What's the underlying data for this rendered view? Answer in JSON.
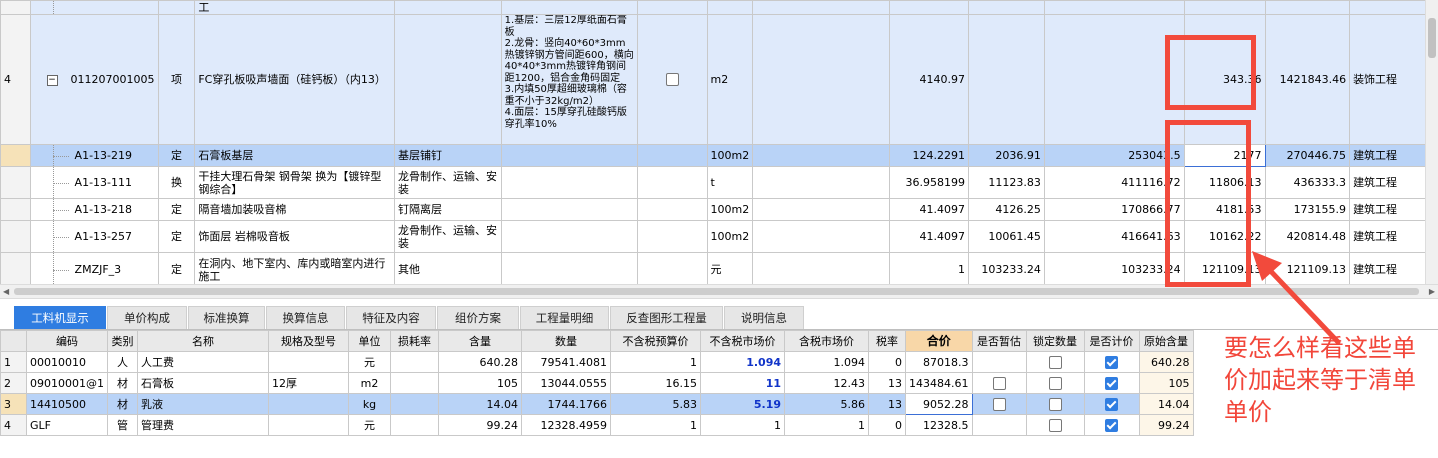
{
  "top_rows": [
    {
      "kind": "cut",
      "idx": "",
      "code": "",
      "type": "",
      "name": "工",
      "feature": "",
      "spec": "",
      "unit": "",
      "qty": "",
      "price": "",
      "total": "",
      "unitprice": "",
      "sum": "",
      "category": ""
    },
    {
      "kind": "item",
      "idx": "4",
      "code": "011207001005",
      "type": "项",
      "name": "FC穿孔板吸声墙面（硅钙板）（内13）",
      "feature": "",
      "spec": "1.基层：三层12厚纸面石膏板\n2.龙骨：竖向40*60*3mm热镀锌钢方管间距600，横向40*40*3mm热镀锌角钢间距1200，铝合金角码固定\n3.内填50厚超细玻璃棉（容重不小于32kg/m2）\n4.面层：15厚穿孔硅酸钙版穿孔率10%",
      "unit": "m2",
      "qty": "4140.97",
      "price": "",
      "total": "",
      "unitprice": "343.36",
      "sum": "1421843.46",
      "category": "装饰工程"
    },
    {
      "kind": "sel",
      "idx": "",
      "code": "A1-13-219",
      "type": "定",
      "name": "石膏板基层",
      "feature": "基层铺钉",
      "spec": "",
      "unit": "100m2",
      "qty": "124.2291",
      "price": "2036.91",
      "total": "253043.5",
      "unitprice": "2177",
      "sum": "270446.75",
      "category": "建筑工程"
    },
    {
      "kind": "plain",
      "idx": "",
      "code": "A1-13-111",
      "type": "换",
      "name": "干挂大理石骨架 钢骨架  换为【镀锌型钢综合】",
      "feature": "龙骨制作、运输、安装",
      "spec": "",
      "unit": "t",
      "qty": "36.958199",
      "price": "11123.83",
      "total": "411116.72",
      "unitprice": "11806.13",
      "sum": "436333.3",
      "category": "建筑工程"
    },
    {
      "kind": "plain",
      "idx": "",
      "code": "A1-13-218",
      "type": "定",
      "name": "隔音墙加装吸音棉",
      "feature": "钉隔离层",
      "spec": "",
      "unit": "100m2",
      "qty": "41.4097",
      "price": "4126.25",
      "total": "170866.77",
      "unitprice": "4181.53",
      "sum": "173155.9",
      "category": "建筑工程"
    },
    {
      "kind": "plain",
      "idx": "",
      "code": "A1-13-257",
      "type": "定",
      "name": "饰面层 岩棉吸音板",
      "feature": "龙骨制作、运输、安装",
      "spec": "",
      "unit": "100m2",
      "qty": "41.4097",
      "price": "10061.45",
      "total": "416641.63",
      "unitprice": "10162.22",
      "sum": "420814.48",
      "category": "建筑工程"
    },
    {
      "kind": "plain",
      "idx": "",
      "code": "ZMZJF_3",
      "type": "定",
      "name": "在洞内、地下室内、库内或暗室内进行施工",
      "feature": "其他",
      "spec": "",
      "unit": "元",
      "qty": "1",
      "price": "103233.24",
      "total": "103233.24",
      "unitprice": "121109.13",
      "sum": "121109.13",
      "category": "建筑工程"
    }
  ],
  "tabs": [
    "工料机显示",
    "单价构成",
    "标准换算",
    "换算信息",
    "特征及内容",
    "组价方案",
    "工程量明细",
    "反查图形工程量",
    "说明信息"
  ],
  "bottom_headers": [
    "",
    "编码",
    "类别",
    "名称",
    "规格及型号",
    "单位",
    "损耗率",
    "含量",
    "数量",
    "不含税预算价",
    "不含税市场价",
    "含税市场价",
    "税率",
    "合价",
    "是否暂估",
    "锁定数量",
    "是否计价",
    "原始含量"
  ],
  "bottom_rows": [
    {
      "idx": "1",
      "code": "00010010",
      "type": "人",
      "name": "人工费",
      "spec": "",
      "unit": "元",
      "loss": "",
      "content": "640.28",
      "qty": "79541.4081",
      "budget": "1",
      "market": "1.094",
      "taxmarket": "1.094",
      "rate": "0",
      "total": "87018.3",
      "est": "none",
      "lock": "off",
      "priced": "on",
      "orig": "640.28"
    },
    {
      "idx": "2",
      "code": "09010001@1",
      "type": "材",
      "name": "石膏板",
      "spec": "12厚",
      "unit": "m2",
      "loss": "",
      "content": "105",
      "qty": "13044.0555",
      "budget": "16.15",
      "market": "11",
      "taxmarket": "12.43",
      "rate": "13",
      "total": "143484.61",
      "est": "off",
      "lock": "off",
      "priced": "on",
      "orig": "105"
    },
    {
      "idx": "3",
      "code": "14410500",
      "type": "材",
      "name": "乳液",
      "spec": "",
      "unit": "kg",
      "loss": "",
      "content": "14.04",
      "qty": "1744.1766",
      "budget": "5.83",
      "market": "5.19",
      "taxmarket": "5.86",
      "rate": "13",
      "total": "9052.28",
      "est": "off",
      "lock": "off",
      "priced": "on",
      "orig": "14.04"
    },
    {
      "idx": "4",
      "code": "GLF",
      "type": "管",
      "name": "管理费",
      "spec": "",
      "unit": "元",
      "loss": "",
      "content": "99.24",
      "qty": "12328.4959",
      "budget": "1",
      "market": "1",
      "taxmarket": "1",
      "rate": "0",
      "total": "12328.5",
      "est": "none",
      "lock": "off",
      "priced": "on",
      "orig": "99.24"
    }
  ],
  "annotation": "要怎么样看这些单价加起来等于清单单价",
  "colors": {
    "accent": "#2f7de1",
    "annotation": "#f24a3c",
    "selected_row": "#b9d3f7",
    "item_row": "#dfeafb"
  }
}
